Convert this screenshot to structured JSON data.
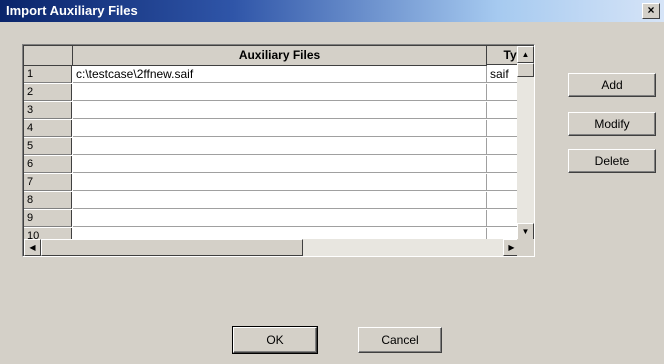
{
  "window": {
    "title": "Import Auxiliary Files",
    "close_glyph": "×"
  },
  "grid": {
    "columns": [
      "Auxiliary Files",
      "Typ"
    ],
    "row_numbers": [
      "1",
      "2",
      "3",
      "4",
      "5",
      "6",
      "7",
      "8",
      "9",
      "10"
    ],
    "rows": [
      [
        "c:\\testcase\\2ffnew.saif",
        "saif"
      ],
      [
        "",
        ""
      ],
      [
        "",
        ""
      ],
      [
        "",
        ""
      ],
      [
        "",
        ""
      ],
      [
        "",
        ""
      ],
      [
        "",
        ""
      ],
      [
        "",
        ""
      ],
      [
        "",
        ""
      ],
      [
        "",
        ""
      ]
    ]
  },
  "side_buttons": {
    "add": "Add",
    "modify": "Modify",
    "delete": "Delete"
  },
  "footer_buttons": {
    "ok": "OK",
    "cancel": "Cancel"
  },
  "icons": {
    "scroll_up": "▲",
    "scroll_down": "▼",
    "scroll_left": "◀",
    "scroll_right": "▶"
  }
}
